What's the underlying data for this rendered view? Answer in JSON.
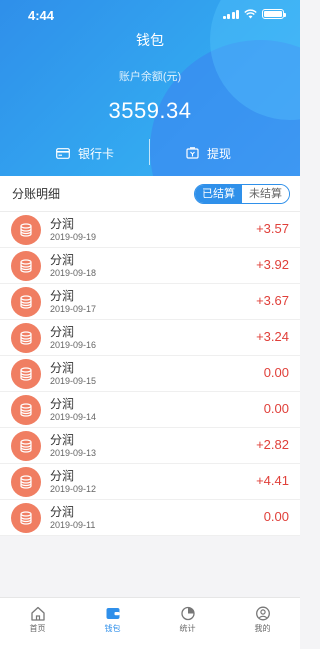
{
  "status_bar": {
    "time": "4:44"
  },
  "header": {
    "title": "钱包",
    "balance_label": "账户余额(元)",
    "balance_value": "3559.34",
    "actions": {
      "bank_card": "银行卡",
      "withdraw": "提现"
    }
  },
  "detail": {
    "title": "分账明细",
    "segments": {
      "settled": "已结算",
      "unsettled": "未结算"
    }
  },
  "records": [
    {
      "name": "分润",
      "date": "2019-09-19",
      "amount": "+3.57"
    },
    {
      "name": "分润",
      "date": "2019-09-18",
      "amount": "+3.92"
    },
    {
      "name": "分润",
      "date": "2019-09-17",
      "amount": "+3.67"
    },
    {
      "name": "分润",
      "date": "2019-09-16",
      "amount": "+3.24"
    },
    {
      "name": "分润",
      "date": "2019-09-15",
      "amount": "0.00"
    },
    {
      "name": "分润",
      "date": "2019-09-14",
      "amount": "0.00"
    },
    {
      "name": "分润",
      "date": "2019-09-13",
      "amount": "+2.82"
    },
    {
      "name": "分润",
      "date": "2019-09-12",
      "amount": "+4.41"
    },
    {
      "name": "分润",
      "date": "2019-09-11",
      "amount": "0.00"
    }
  ],
  "tabbar": {
    "home": "首页",
    "wallet": "钱包",
    "stats": "统计",
    "mine": "我的"
  },
  "colors": {
    "accent": "#2f8fea",
    "amount": "#e0403a",
    "record_icon": "#f07e62"
  },
  "icons": {
    "record": "coin-stack-icon",
    "bank_card": "card-icon",
    "withdraw": "withdraw-icon"
  }
}
